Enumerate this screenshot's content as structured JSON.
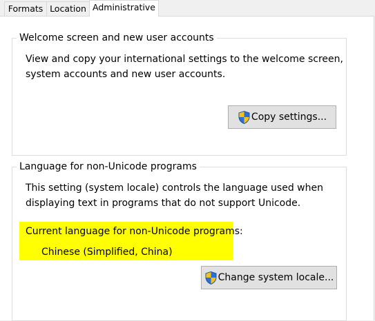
{
  "tabs": [
    {
      "label": "Formats"
    },
    {
      "label": "Location"
    },
    {
      "label": "Administrative",
      "selected": true
    }
  ],
  "welcome_group": {
    "title": "Welcome screen and new user accounts",
    "description_lines": [
      "View and copy your international settings to the welcome screen,",
      "system accounts and new user accounts."
    ],
    "button_label": "Copy settings...",
    "button_icon": "uac-shield-icon"
  },
  "unicode_group": {
    "title": "Language for non-Unicode programs",
    "description_lines": [
      "This setting (system locale) controls the language used when",
      "displaying text in programs that do not support Unicode."
    ],
    "current_label": "Current language for non-Unicode programs:",
    "current_value": "Chinese (Simplified, China)",
    "highlight_color": "#ffff00",
    "button_label": "Change system locale...",
    "button_icon": "uac-shield-icon"
  }
}
